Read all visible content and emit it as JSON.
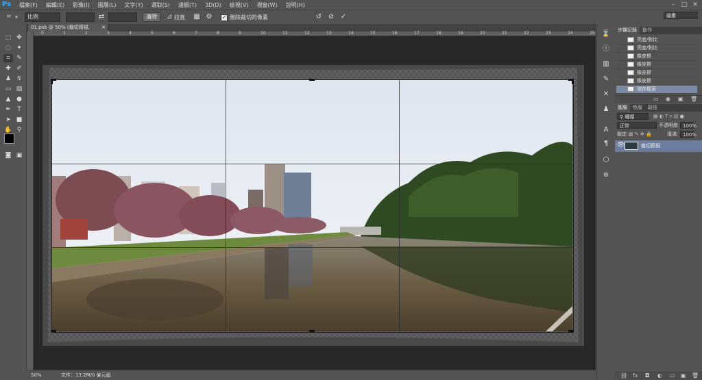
{
  "app": {
    "logo": "Ps"
  },
  "menu": [
    "檔案(F)",
    "編輯(E)",
    "影像(I)",
    "圖層(L)",
    "文字(Y)",
    "選取(S)",
    "濾鏡(T)",
    "3D(D)",
    "檢視(V)",
    "視窗(W)",
    "說明(H)"
  ],
  "window_controls": [
    "–",
    "□",
    "✕"
  ],
  "options_bar": {
    "ratio_value": "比例",
    "swap_icon": "⇄",
    "clear_label": "清除",
    "straighten_label": "拉直",
    "delete_cropped_label": "刪除裁切的像素",
    "delete_cropped_checked": true,
    "workspace": "繪畫"
  },
  "document": {
    "tab_label": "01.psb @ 50% (裁切預視, RGB/8*)",
    "zoom": "50%",
    "file_info": "文件：13.2M/0 位元組"
  },
  "ruler_ticks": [
    "0",
    "1",
    "2",
    "3",
    "4",
    "5",
    "6",
    "7",
    "8",
    "9",
    "10",
    "11",
    "12",
    "13",
    "14",
    "15",
    "16",
    "17",
    "18",
    "19",
    "20",
    "21",
    "22",
    "23",
    "24",
    "25"
  ],
  "history_panel": {
    "tabs": [
      "步驟記錄",
      "動作"
    ],
    "items": [
      "亮度/對比",
      "亮度/對比",
      "橡皮擦",
      "橡皮擦",
      "橡皮擦",
      "橡皮擦",
      "儲存檔案"
    ],
    "selected_index": 6
  },
  "layers_panel": {
    "tabs": [
      "圖層",
      "色版",
      "路徑"
    ],
    "filter_kind": "種類",
    "blend_mode": "正常",
    "opacity_label": "不透明度:",
    "opacity_value": "100%",
    "lock_label": "鎖定:",
    "fill_label": "填滿:",
    "fill_value": "100%",
    "layer_name": "裁切預視"
  },
  "colors": {
    "selection_highlight": "#7b8ba6",
    "layer_highlight": "#6c7da0",
    "ps_blue": "#31a8ff"
  }
}
